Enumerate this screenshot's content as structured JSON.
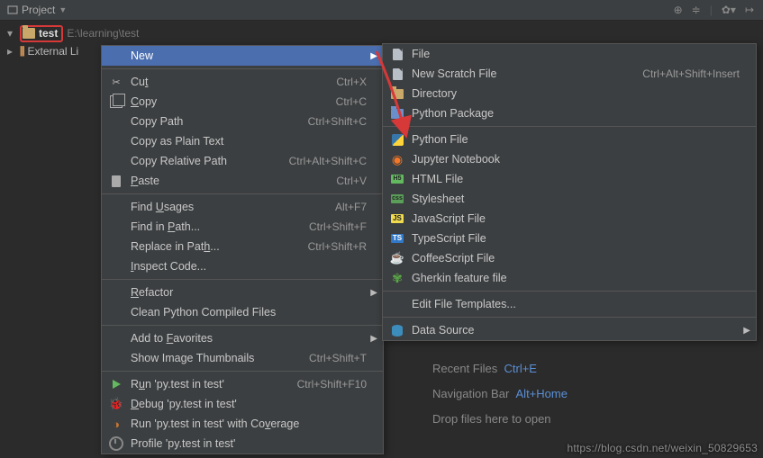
{
  "toolbar": {
    "project_label": "Project"
  },
  "tree": {
    "root_name": "test",
    "root_path": "E:\\learning\\test",
    "external": "External Li"
  },
  "context_menu": [
    {
      "icon": "",
      "label": "New",
      "shortcut": "",
      "sub": true,
      "sel": true
    },
    "-",
    {
      "icon": "scissors",
      "label": "Cut",
      "u": "t",
      "shortcut": "Ctrl+X"
    },
    {
      "icon": "copy",
      "label": "Copy",
      "u": "C",
      "shortcut": "Ctrl+C"
    },
    {
      "icon": "",
      "label": "Copy Path",
      "shortcut": "Ctrl+Shift+C"
    },
    {
      "icon": "",
      "label": "Copy as Plain Text",
      "shortcut": ""
    },
    {
      "icon": "",
      "label": "Copy Relative Path",
      "shortcut": "Ctrl+Alt+Shift+C"
    },
    {
      "icon": "paste",
      "label": "Paste",
      "u": "P",
      "shortcut": "Ctrl+V"
    },
    "-",
    {
      "icon": "",
      "label": "Find Usages",
      "u": "U",
      "shortcut": "Alt+F7"
    },
    {
      "icon": "",
      "label": "Find in Path...",
      "u": "P",
      "shortcut": "Ctrl+Shift+F"
    },
    {
      "icon": "",
      "label": "Replace in Path...",
      "u": "h",
      "shortcut": "Ctrl+Shift+R"
    },
    {
      "icon": "",
      "label": "Inspect Code...",
      "u": "I",
      "shortcut": ""
    },
    "-",
    {
      "icon": "",
      "label": "Refactor",
      "u": "R",
      "shortcut": "",
      "sub": true
    },
    {
      "icon": "",
      "label": "Clean Python Compiled Files",
      "shortcut": ""
    },
    "-",
    {
      "icon": "",
      "label": "Add to Favorites",
      "u": "F",
      "shortcut": "",
      "sub": true
    },
    {
      "icon": "",
      "label": "Show Image Thumbnails",
      "shortcut": "Ctrl+Shift+T"
    },
    "-",
    {
      "icon": "play",
      "label": "Run 'py.test in test'",
      "u": "u",
      "shortcut": "Ctrl+Shift+F10"
    },
    {
      "icon": "bug",
      "label": "Debug 'py.test in test'",
      "u": "D",
      "shortcut": ""
    },
    {
      "icon": "coverage",
      "label": "Run 'py.test in test' with Coverage",
      "u": "v",
      "shortcut": ""
    },
    {
      "icon": "profile",
      "label": "Profile 'py.test in test'",
      "shortcut": ""
    }
  ],
  "new_submenu": [
    {
      "icon": "file",
      "label": "File"
    },
    {
      "icon": "file",
      "label": "New Scratch File",
      "shortcut": "Ctrl+Alt+Shift+Insert"
    },
    {
      "icon": "dir",
      "label": "Directory"
    },
    {
      "icon": "pkg",
      "label": "Python Package"
    },
    "-",
    {
      "icon": "py",
      "label": "Python File"
    },
    {
      "icon": "jup",
      "label": "Jupyter Notebook"
    },
    {
      "icon": "html",
      "label": "HTML File"
    },
    {
      "icon": "css",
      "label": "Stylesheet"
    },
    {
      "icon": "js",
      "label": "JavaScript File"
    },
    {
      "icon": "ts",
      "label": "TypeScript File"
    },
    {
      "icon": "coffee",
      "label": "CoffeeScript File"
    },
    {
      "icon": "gherkin",
      "label": "Gherkin feature file"
    },
    "-",
    {
      "icon": "",
      "label": "Edit File Templates..."
    },
    "-",
    {
      "icon": "db",
      "label": "Data Source",
      "sub": true
    }
  ],
  "empty_panel": {
    "recent": "Recent Files",
    "recent_sc": "Ctrl+E",
    "nav": "Navigation Bar",
    "nav_sc": "Alt+Home",
    "drop": "Drop files here to open"
  },
  "watermark": "https://blog.csdn.net/weixin_50829653"
}
